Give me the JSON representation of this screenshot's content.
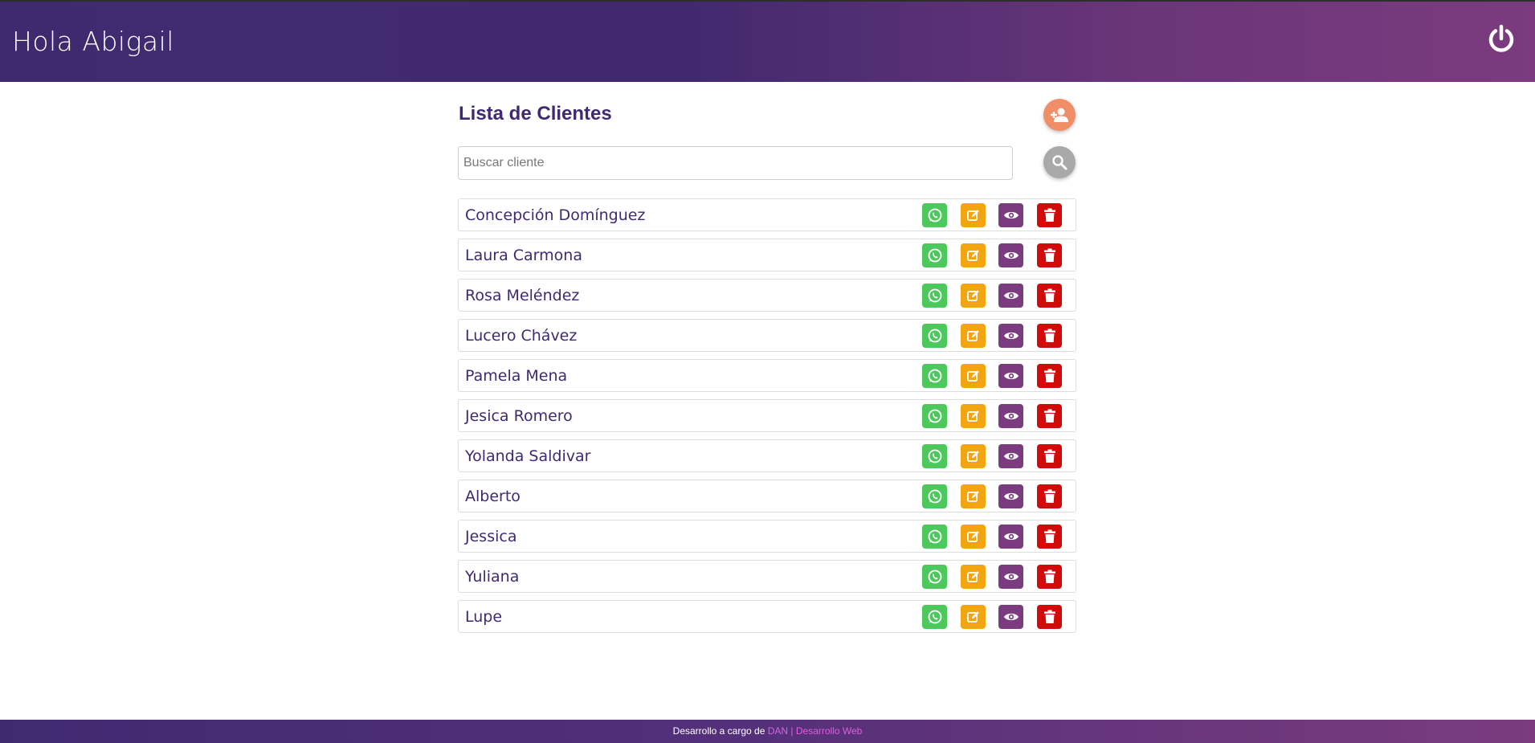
{
  "header": {
    "greeting": "Hola Abigail",
    "logout_icon": "power-icon"
  },
  "main": {
    "title": "Lista de Clientes",
    "add_client_icon": "add-user-icon",
    "search": {
      "placeholder": "Buscar cliente",
      "value": "",
      "button_icon": "search-icon"
    },
    "actions": [
      {
        "name": "whatsapp",
        "icon": "whatsapp-icon",
        "color": "#4cc85d"
      },
      {
        "name": "edit",
        "icon": "edit-icon",
        "color": "#f3a510"
      },
      {
        "name": "view",
        "icon": "eye-icon",
        "color": "#7a3b7f"
      },
      {
        "name": "delete",
        "icon": "trash-icon",
        "color": "#d10a0a"
      }
    ],
    "clients": [
      {
        "name": "Concepción Domínguez"
      },
      {
        "name": "Laura Carmona"
      },
      {
        "name": "Rosa Meléndez"
      },
      {
        "name": "Lucero Chávez"
      },
      {
        "name": "Pamela Mena"
      },
      {
        "name": "Jesica Romero"
      },
      {
        "name": "Yolanda Saldivar"
      },
      {
        "name": "Alberto"
      },
      {
        "name": "Jessica"
      },
      {
        "name": "Yuliana"
      },
      {
        "name": "Lupe"
      }
    ]
  },
  "footer": {
    "prefix": "Desarrollo a cargo de ",
    "brand": "DAN",
    "separator": " | ",
    "link": "Desarrollo Web"
  },
  "colors": {
    "primary": "#3f2a70",
    "accent": "#7b3b7e",
    "add_button": "#ef8e67",
    "search_button": "#a9a9a9",
    "footer_link": "#e05ee0"
  }
}
